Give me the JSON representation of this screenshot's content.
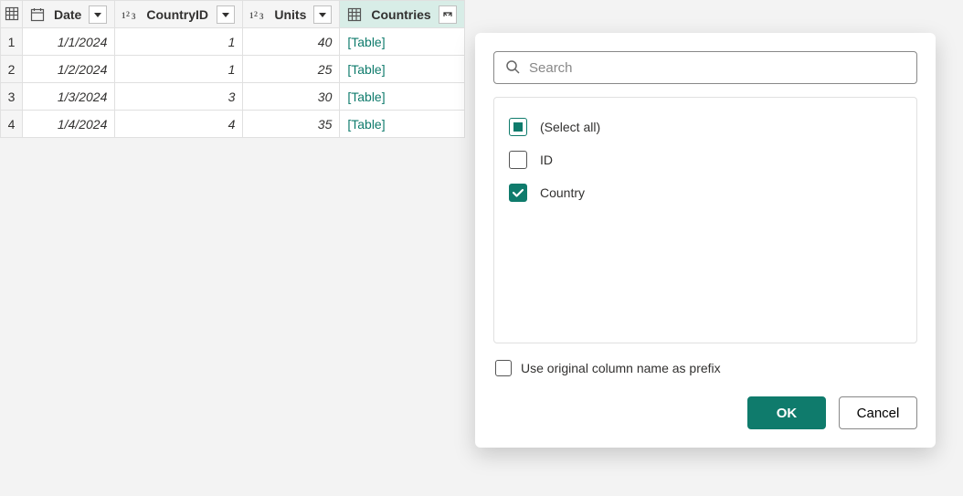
{
  "columns": {
    "date": {
      "name": "Date"
    },
    "countryid": {
      "name": "CountryID"
    },
    "units": {
      "name": "Units"
    },
    "countries": {
      "name": "Countries"
    }
  },
  "rows": [
    {
      "n": "1",
      "date": "1/1/2024",
      "countryid": "1",
      "units": "40",
      "countries": "[Table]"
    },
    {
      "n": "2",
      "date": "1/2/2024",
      "countryid": "1",
      "units": "25",
      "countries": "[Table]"
    },
    {
      "n": "3",
      "date": "1/3/2024",
      "countryid": "3",
      "units": "30",
      "countries": "[Table]"
    },
    {
      "n": "4",
      "date": "1/4/2024",
      "countryid": "4",
      "units": "35",
      "countries": "[Table]"
    }
  ],
  "popup": {
    "search_placeholder": "Search",
    "items": [
      {
        "label": "(Select all)",
        "state": "indeterminate"
      },
      {
        "label": "ID",
        "state": "unchecked"
      },
      {
        "label": "Country",
        "state": "checked"
      }
    ],
    "prefix_label": "Use original column name as prefix",
    "prefix_checked": false,
    "ok_label": "OK",
    "cancel_label": "Cancel"
  }
}
